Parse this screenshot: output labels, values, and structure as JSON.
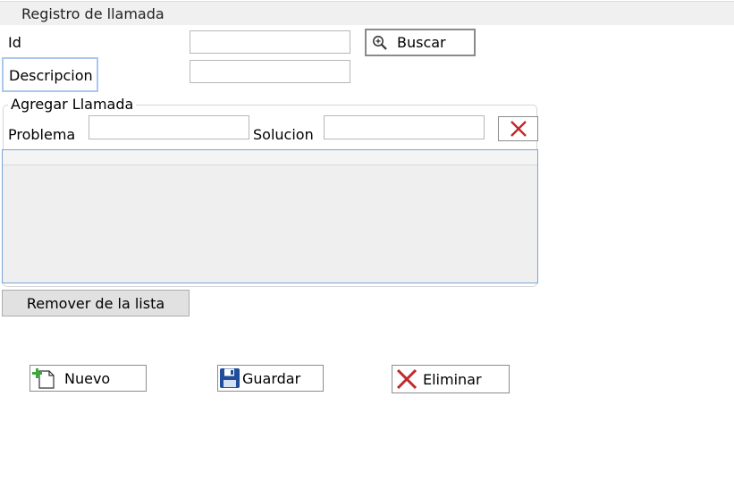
{
  "window": {
    "title": "Registro de llamada"
  },
  "form": {
    "id_label": "Id",
    "id_value": "",
    "descripcion_label": "Descripcion",
    "descripcion_value": "",
    "buscar_label": "Buscar"
  },
  "group": {
    "title": "Agregar Llamada",
    "problema_label": "Problema",
    "problema_value": "",
    "solucion_label": "Solucion",
    "solucion_value": ""
  },
  "list": {
    "rows": []
  },
  "actions": {
    "remove_label": "Remover de la lista",
    "nuevo_label": "Nuevo",
    "guardar_label": "Guardar",
    "eliminar_label": "Eliminar"
  },
  "icons": {
    "buscar": "zoom-in-icon",
    "clear": "close-icon",
    "nuevo": "new-document-icon",
    "guardar": "save-icon",
    "eliminar": "delete-icon"
  },
  "colors": {
    "delete_red": "#c0282a",
    "save_blue": "#1f4f9a",
    "new_green": "#3ca83c",
    "focus_border": "#aac8ee",
    "grid_border": "#7ba4d6"
  }
}
